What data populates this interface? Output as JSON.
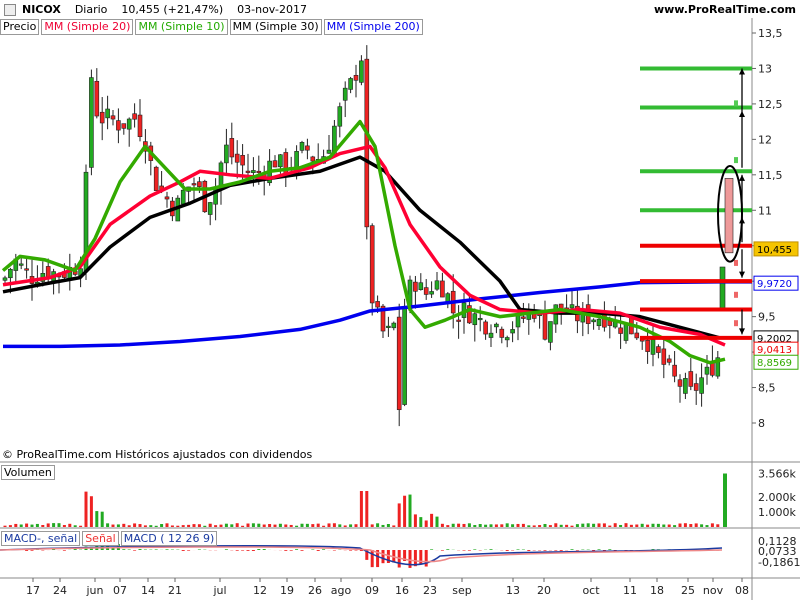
{
  "header": {
    "symbol": "NICOX",
    "period": "Diario",
    "last": "10,455 (+21,47%)",
    "date": "03-nov-2017",
    "source": "www.ProRealTime.com"
  },
  "legend": {
    "price": "Precio",
    "sma20": "MM (Simple 20)",
    "sma10": "MM (Simple 10)",
    "sma30": "MM (Simple 30)",
    "sma200": "MM (Simple 200)"
  },
  "credit": "© ProRealTime.com  Históricos ajustados con dividendos",
  "volume_title": "Volumen",
  "macd_legend": {
    "a": "MACD-, señal",
    "b": "Señal",
    "c": "MACD ( 12 26 9)"
  },
  "colors": {
    "sma20": "#ff0033",
    "sma10": "#33aa00",
    "sma30": "#000000",
    "sma200": "#0000ee",
    "up": "#22aa22",
    "down": "#ee2222",
    "level_green": "#33bb33",
    "level_red": "#ee0000"
  },
  "chart_data": {
    "type": "line",
    "ylim": [
      7.55,
      13.6
    ],
    "y_ticks": [
      "13,5",
      "13",
      "12,5",
      "12",
      "11,5",
      "11",
      "10,5",
      "10",
      "9,5",
      "9",
      "8,5",
      "8"
    ],
    "y_tick_values": [
      13.5,
      13,
      12.5,
      12,
      11.5,
      11,
      10.5,
      10,
      9.5,
      9,
      8.5,
      8
    ],
    "x_labels": [
      "17",
      "24",
      "jun",
      "07",
      "14",
      "21",
      "jul",
      "12",
      "19",
      "26",
      "ago",
      "09",
      "16",
      "23",
      "sep",
      "13",
      "20",
      "oct",
      "11",
      "18",
      "25",
      "nov",
      "08"
    ],
    "price_labels": [
      {
        "text": "10,455",
        "value": 10.455,
        "bg": "#f5c400",
        "fg": "#000"
      },
      {
        "text": "9,9720",
        "value": 9.972,
        "bg": "#ffffff",
        "fg": "#0000ee"
      },
      {
        "text": "9,2002",
        "value": 9.2002,
        "bg": "#ffffff",
        "fg": "#000"
      },
      {
        "text": "9,0413",
        "value": 9.0413,
        "bg": "#ffffff",
        "fg": "#ee0000"
      },
      {
        "text": "8,8569",
        "value": 8.8569,
        "bg": "#ffffff",
        "fg": "#33aa00"
      }
    ],
    "levels": [
      {
        "value": 13.0,
        "color": "green"
      },
      {
        "value": 12.45,
        "color": "green"
      },
      {
        "value": 11.55,
        "color": "green"
      },
      {
        "value": 11.0,
        "color": "green"
      },
      {
        "value": 10.5,
        "color": "red"
      },
      {
        "value": 10.0,
        "color": "red"
      },
      {
        "value": 9.6,
        "color": "red"
      },
      {
        "value": 9.2,
        "color": "red"
      }
    ],
    "series": [
      {
        "name": "MM (Simple 200)",
        "values": [
          [
            3,
            9.08
          ],
          [
            60,
            9.08
          ],
          [
            120,
            9.1
          ],
          [
            180,
            9.15
          ],
          [
            240,
            9.22
          ],
          [
            300,
            9.32
          ],
          [
            340,
            9.45
          ],
          [
            370,
            9.58
          ],
          [
            420,
            9.65
          ],
          [
            480,
            9.75
          ],
          [
            540,
            9.84
          ],
          [
            600,
            9.92
          ],
          [
            640,
            9.98
          ],
          [
            720,
            9.99
          ],
          [
            752,
            9.99
          ]
        ]
      },
      {
        "name": "MM (Simple 30)",
        "values": [
          [
            3,
            9.85
          ],
          [
            40,
            9.95
          ],
          [
            80,
            10.05
          ],
          [
            110,
            10.48
          ],
          [
            150,
            10.9
          ],
          [
            190,
            11.1
          ],
          [
            230,
            11.35
          ],
          [
            270,
            11.45
          ],
          [
            320,
            11.55
          ],
          [
            360,
            11.75
          ],
          [
            385,
            11.55
          ],
          [
            420,
            11.0
          ],
          [
            460,
            10.55
          ],
          [
            500,
            10.0
          ],
          [
            520,
            9.6
          ],
          [
            560,
            9.55
          ],
          [
            600,
            9.55
          ],
          [
            640,
            9.5
          ],
          [
            680,
            9.35
          ],
          [
            720,
            9.2
          ]
        ]
      },
      {
        "name": "MM (Simple 20)",
        "values": [
          [
            3,
            9.95
          ],
          [
            50,
            10.05
          ],
          [
            80,
            10.2
          ],
          [
            110,
            10.8
          ],
          [
            150,
            11.2
          ],
          [
            180,
            11.4
          ],
          [
            200,
            11.55
          ],
          [
            230,
            11.5
          ],
          [
            270,
            11.45
          ],
          [
            310,
            11.6
          ],
          [
            340,
            11.8
          ],
          [
            370,
            11.9
          ],
          [
            385,
            11.6
          ],
          [
            410,
            10.8
          ],
          [
            440,
            10.2
          ],
          [
            470,
            9.8
          ],
          [
            500,
            9.6
          ],
          [
            540,
            9.55
          ],
          [
            580,
            9.6
          ],
          [
            620,
            9.55
          ],
          [
            660,
            9.35
          ],
          [
            700,
            9.25
          ],
          [
            725,
            9.1
          ]
        ]
      },
      {
        "name": "MM (Simple 10)",
        "values": [
          [
            3,
            10.15
          ],
          [
            20,
            10.35
          ],
          [
            45,
            10.3
          ],
          [
            75,
            10.15
          ],
          [
            95,
            10.6
          ],
          [
            120,
            11.4
          ],
          [
            145,
            11.9
          ],
          [
            165,
            11.6
          ],
          [
            185,
            11.3
          ],
          [
            210,
            11.3
          ],
          [
            240,
            11.4
          ],
          [
            270,
            11.55
          ],
          [
            300,
            11.6
          ],
          [
            330,
            11.75
          ],
          [
            360,
            12.25
          ],
          [
            375,
            11.9
          ],
          [
            395,
            10.5
          ],
          [
            410,
            9.6
          ],
          [
            425,
            9.35
          ],
          [
            445,
            9.45
          ],
          [
            470,
            9.6
          ],
          [
            500,
            9.5
          ],
          [
            530,
            9.55
          ],
          [
            560,
            9.6
          ],
          [
            600,
            9.5
          ],
          [
            640,
            9.35
          ],
          [
            670,
            9.15
          ],
          [
            690,
            8.95
          ],
          [
            710,
            8.85
          ],
          [
            725,
            8.9
          ]
        ]
      }
    ]
  },
  "volume": {
    "ticks": [
      "3.566k",
      "2.000k",
      "1.000k"
    ],
    "tick_values": [
      3566,
      2000,
      1000
    ],
    "max": 3800
  },
  "macd": {
    "ticks": [
      "0,1128",
      "0,0733",
      "-0,1861"
    ],
    "tick_values": [
      0.1128,
      0.0733,
      -0.1861
    ]
  }
}
